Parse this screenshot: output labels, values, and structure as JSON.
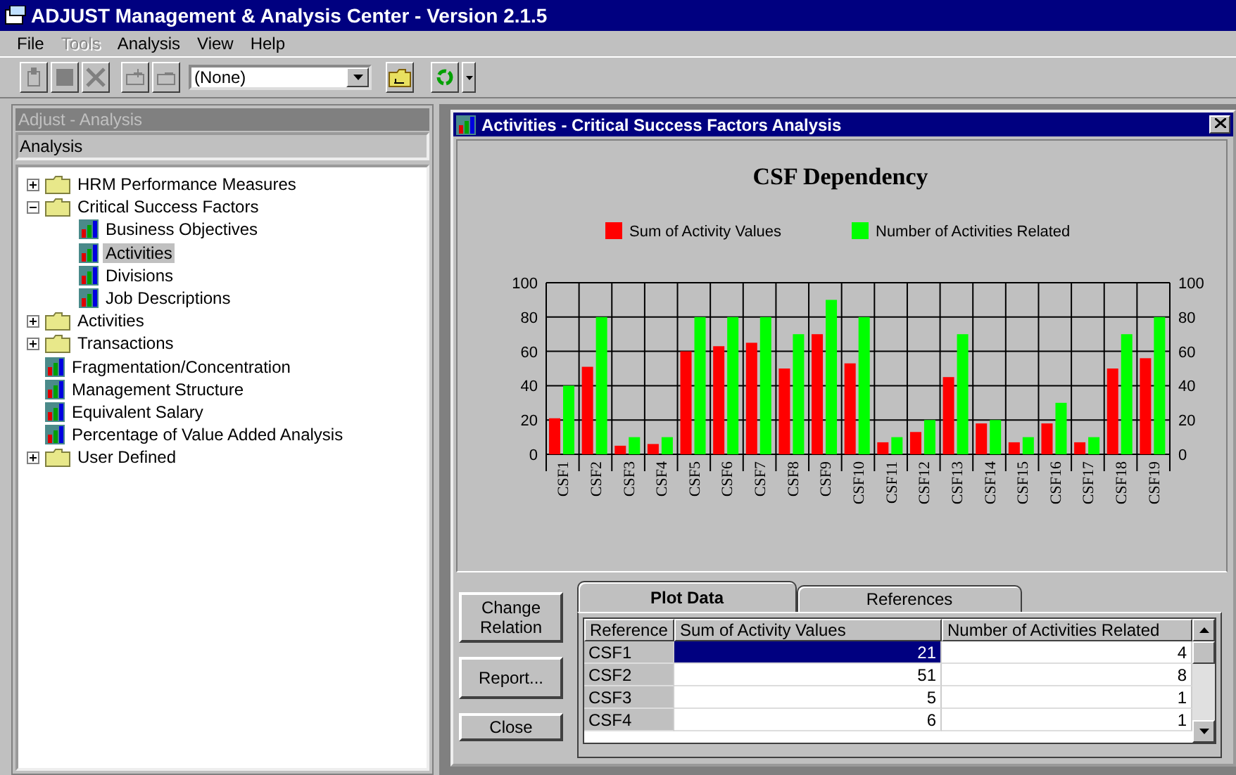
{
  "window": {
    "title": "ADJUST Management & Analysis Center - Version 2.1.5"
  },
  "menu": [
    {
      "label": "File",
      "disabled": false
    },
    {
      "label": "Tools",
      "disabled": true
    },
    {
      "label": "Analysis",
      "disabled": false
    },
    {
      "label": "View",
      "disabled": false
    },
    {
      "label": "Help",
      "disabled": false
    }
  ],
  "toolbar": {
    "combo": "(None)"
  },
  "sidebar": {
    "title": "Adjust - Analysis",
    "header": "Analysis",
    "tree": [
      {
        "label": "HRM Performance Measures",
        "kind": "folder",
        "expanded": false,
        "selected": false
      },
      {
        "label": "Critical Success Factors",
        "kind": "folder",
        "expanded": true,
        "selected": false,
        "children": [
          {
            "label": "Business Objectives",
            "kind": "chart",
            "selected": false
          },
          {
            "label": "Activities",
            "kind": "chart",
            "selected": true
          },
          {
            "label": "Divisions",
            "kind": "chart",
            "selected": false
          },
          {
            "label": "Job Descriptions",
            "kind": "chart",
            "selected": false
          }
        ]
      },
      {
        "label": "Activities",
        "kind": "folder",
        "expanded": false,
        "selected": false
      },
      {
        "label": "Transactions",
        "kind": "folder",
        "expanded": false,
        "selected": false
      },
      {
        "label": "Fragmentation/Concentration",
        "kind": "chart",
        "selected": false
      },
      {
        "label": "Management Structure",
        "kind": "chart",
        "selected": false
      },
      {
        "label": "Equivalent Salary",
        "kind": "chart",
        "selected": false
      },
      {
        "label": "Percentage of Value Added Analysis",
        "kind": "chart",
        "selected": false
      },
      {
        "label": "User Defined",
        "kind": "folder",
        "expanded": false,
        "selected": false
      }
    ]
  },
  "child_window": {
    "title": "Activities - Critical Success Factors Analysis",
    "chart_data": {
      "type": "bar",
      "title": "CSF Dependency",
      "categories": [
        "CSF1",
        "CSF2",
        "CSF3",
        "CSF4",
        "CSF5",
        "CSF6",
        "CSF7",
        "CSF8",
        "CSF9",
        "CSF10",
        "CSF11",
        "CSF12",
        "CSF13",
        "CSF14",
        "CSF15",
        "CSF16",
        "CSF17",
        "CSF18",
        "CSF19"
      ],
      "series": [
        {
          "name": "Sum of Activity Values",
          "color": "#ff0000",
          "values": [
            21,
            51,
            5,
            6,
            60,
            63,
            65,
            50,
            70,
            53,
            7,
            13,
            45,
            18,
            7,
            18,
            7,
            50,
            56
          ]
        },
        {
          "name": "Number of Activities Related",
          "color": "#00ff00",
          "values": [
            40,
            80,
            10,
            10,
            80,
            80,
            80,
            70,
            90,
            80,
            10,
            20,
            70,
            20,
            10,
            30,
            10,
            70,
            80
          ]
        }
      ],
      "ylim": [
        0,
        100
      ],
      "yticks": [
        0,
        20,
        40,
        60,
        80,
        100
      ],
      "y2ticks": [
        0,
        20,
        40,
        60,
        80,
        100
      ],
      "y2lim": [
        0,
        100
      ],
      "grid": true,
      "legend": true
    },
    "buttons": [
      "Change Relation",
      "Report...",
      "Close"
    ],
    "tabs": [
      {
        "label": "Plot Data",
        "selected": true
      },
      {
        "label": "References",
        "selected": false
      }
    ],
    "table": {
      "columns": [
        "Reference",
        "Sum of Activity Values",
        "Number of Activities Related"
      ],
      "rows": [
        {
          "cells": [
            {
              "text": "CSF1",
              "selected": false
            },
            {
              "text": "21",
              "selected": true
            },
            {
              "text": "4",
              "selected": false
            }
          ]
        },
        {
          "cells": [
            {
              "text": "CSF2",
              "selected": false
            },
            {
              "text": "51",
              "selected": false
            },
            {
              "text": "8",
              "selected": false
            }
          ]
        },
        {
          "cells": [
            {
              "text": "CSF3",
              "selected": false
            },
            {
              "text": "5",
              "selected": false
            },
            {
              "text": "1",
              "selected": false
            }
          ]
        },
        {
          "cells": [
            {
              "text": "CSF4",
              "selected": false
            },
            {
              "text": "6",
              "selected": false
            },
            {
              "text": "1",
              "selected": false
            }
          ]
        }
      ]
    }
  }
}
